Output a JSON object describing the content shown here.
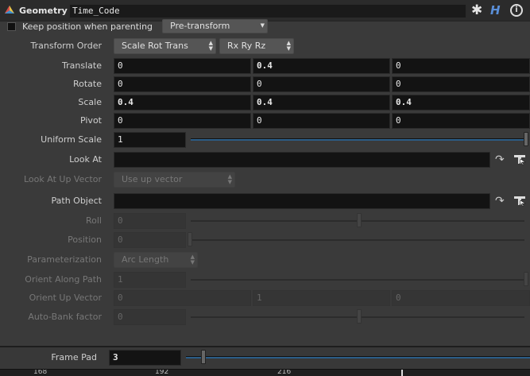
{
  "header": {
    "node_type": "Geometry",
    "node_name": "Time_Code",
    "help_icon": "H",
    "info_icon": "i"
  },
  "keep_position": {
    "label": "Keep position when parenting",
    "checked": false,
    "menu_value": "Pre-transform"
  },
  "transform_order": {
    "label": "Transform Order",
    "order_value": "Scale Rot Trans",
    "rot_value": "Rx Ry Rz"
  },
  "vectors": [
    {
      "label": "Translate",
      "values": [
        "0",
        "0.4",
        "0"
      ],
      "bold": [
        false,
        true,
        false
      ]
    },
    {
      "label": "Rotate",
      "values": [
        "0",
        "0",
        "0"
      ],
      "bold": [
        false,
        false,
        false
      ]
    },
    {
      "label": "Scale",
      "values": [
        "0.4",
        "0.4",
        "0.4"
      ],
      "bold": [
        true,
        true,
        true
      ]
    },
    {
      "label": "Pivot",
      "values": [
        "0",
        "0",
        "0"
      ],
      "bold": [
        false,
        false,
        false
      ]
    }
  ],
  "uniform_scale": {
    "label": "Uniform Scale",
    "value": "1",
    "slider_fraction": 1.0
  },
  "look_at": {
    "label": "Look At",
    "value": ""
  },
  "look_at_up": {
    "label": "Look At Up Vector",
    "value": "Use up vector"
  },
  "path_object": {
    "label": "Path Object",
    "value": ""
  },
  "roll": {
    "label": "Roll",
    "value": "0",
    "slider_fraction": 0.5
  },
  "position": {
    "label": "Position",
    "value": "0",
    "slider_fraction": 0.0
  },
  "parameterization": {
    "label": "Parameterization",
    "value": "Arc Length"
  },
  "orient_along_path": {
    "label": "Orient Along Path",
    "value": "1",
    "slider_fraction": 1.0
  },
  "orient_up_vector": {
    "label": "Orient Up Vector",
    "values": [
      "0",
      "1",
      "0"
    ]
  },
  "auto_bank": {
    "label": "Auto-Bank factor",
    "value": "0",
    "slider_fraction": 0.5
  },
  "frame_pad": {
    "label": "Frame Pad",
    "value": "3",
    "slider_fraction": 0.05
  },
  "timeline": {
    "ticks": [
      "168",
      "192",
      "216"
    ]
  },
  "colors": {
    "accent": "#2b5d87",
    "background": "#3a3a3a",
    "field": "#131313"
  }
}
